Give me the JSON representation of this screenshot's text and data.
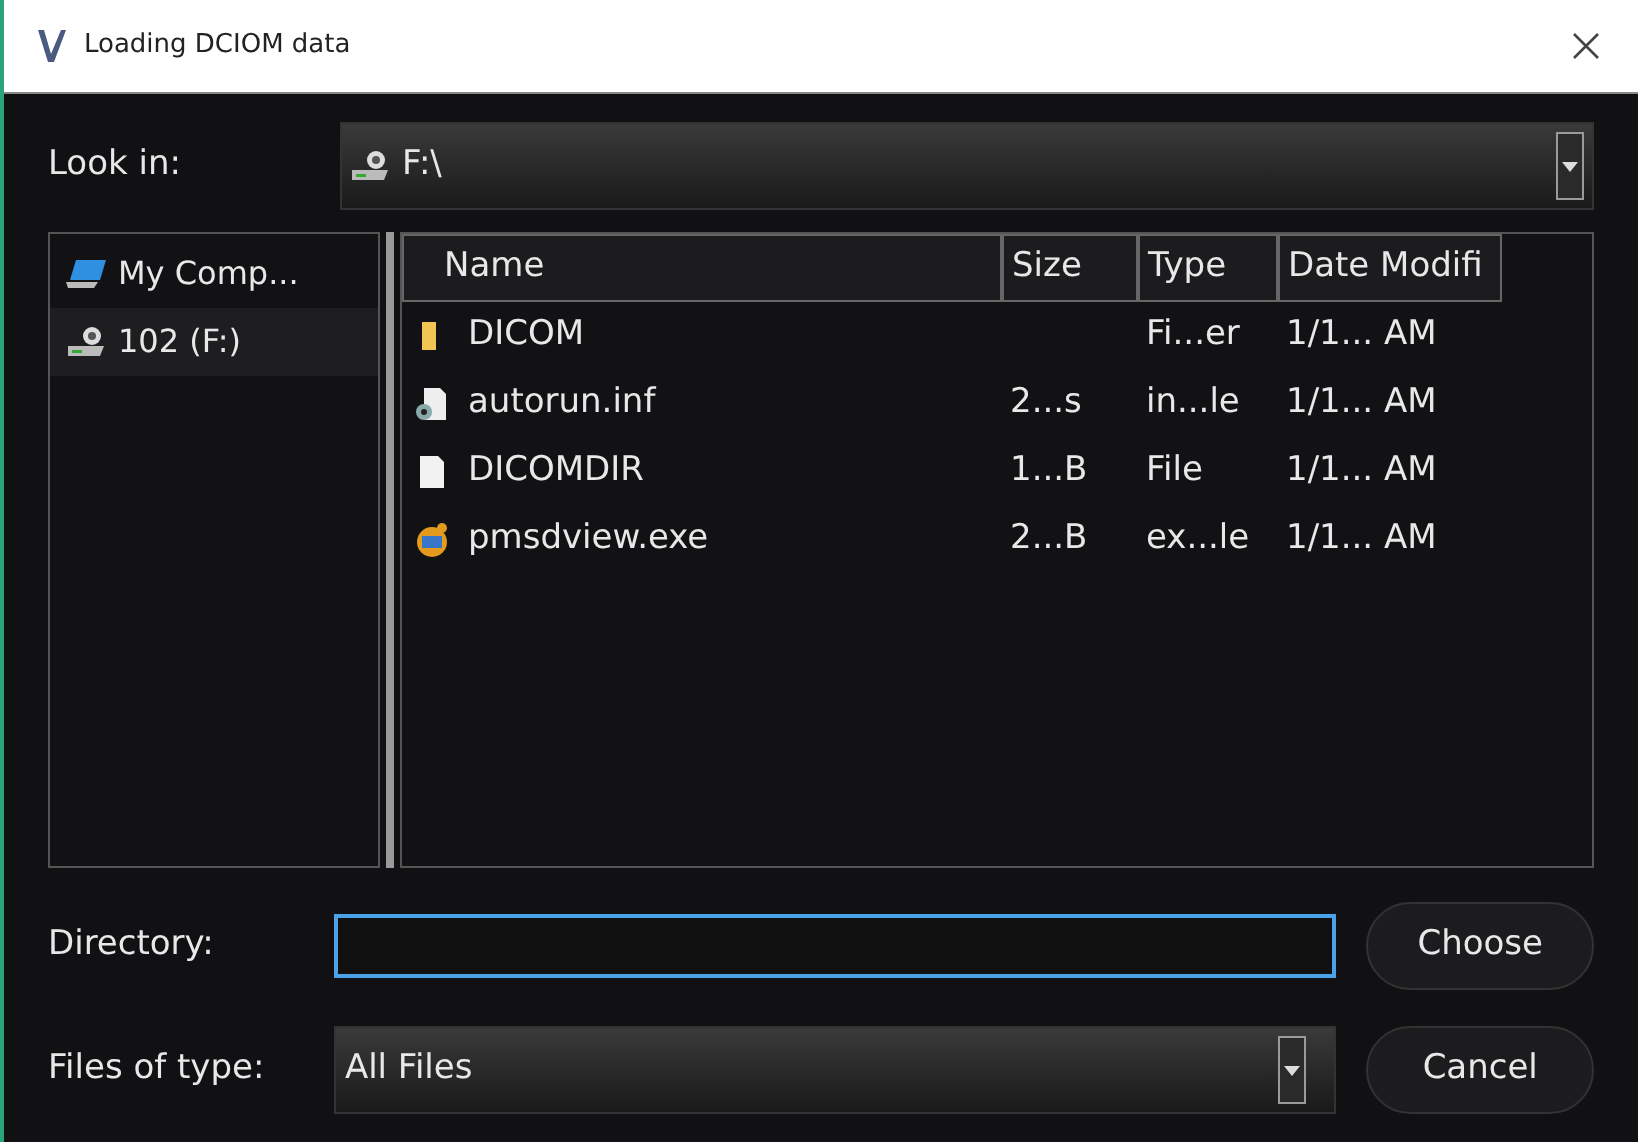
{
  "window": {
    "title": "Loading DCIOM data"
  },
  "look_in": {
    "label": "Look in:",
    "value": "F:\\",
    "kind": "drive"
  },
  "places": [
    {
      "label": "My Comp...",
      "kind": "computer",
      "selected": false
    },
    {
      "label": "102 (F:)",
      "kind": "drive",
      "selected": true
    }
  ],
  "table": {
    "columns": [
      "Name",
      "Size",
      "Type",
      "Date Modifi"
    ],
    "rows": [
      {
        "kind": "folder",
        "cells": [
          "DICOM",
          "",
          "Fi...er",
          "1/1... AM"
        ]
      },
      {
        "kind": "settings-file",
        "cells": [
          "autorun.inf",
          "2...s",
          "in...le",
          "1/1... AM"
        ]
      },
      {
        "kind": "file",
        "cells": [
          "DICOMDIR",
          "1...B",
          "File",
          "1/1... AM"
        ]
      },
      {
        "kind": "app",
        "cells": [
          "pmsdview.exe",
          "2...B",
          "ex...le",
          "1/1... AM"
        ]
      }
    ]
  },
  "directory": {
    "label": "Directory:",
    "button": "Choose"
  },
  "file_type": {
    "label": "Files of type:",
    "value": "All Files",
    "button": "Cancel"
  }
}
